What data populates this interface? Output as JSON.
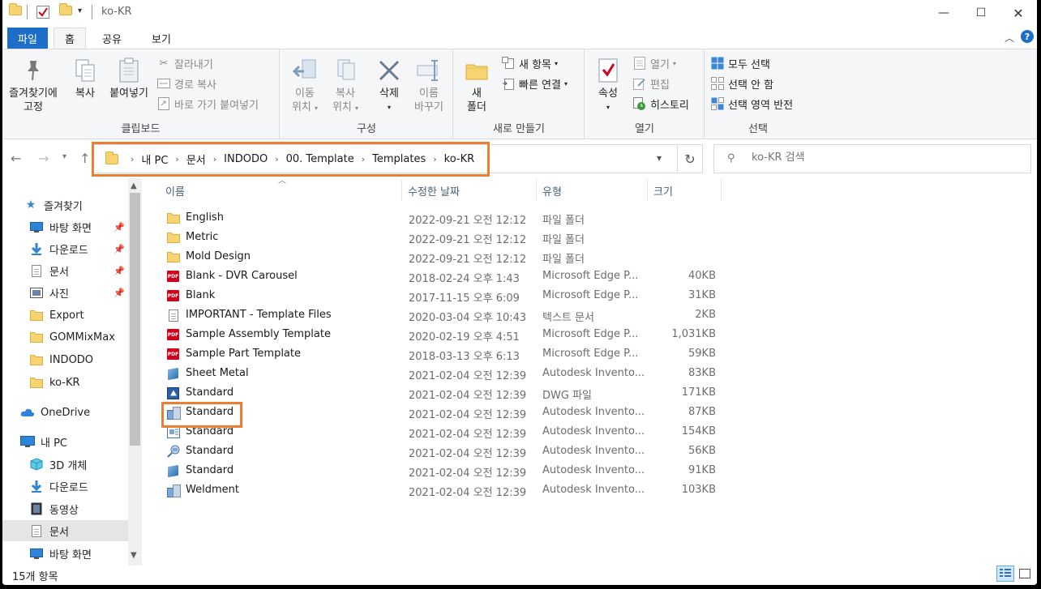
{
  "window": {
    "title": "ko-KR"
  },
  "tabs": [
    "파일",
    "홈",
    "공유",
    "보기"
  ],
  "ribbon": {
    "clipboard": {
      "label": "클립보드",
      "pin": "즐겨찾기에\n고정",
      "pin_l1": "즐겨찾기에",
      "pin_l2": "고정",
      "copy": "복사",
      "paste": "붙여넣기",
      "cut": "잘라내기",
      "copy_path": "경로 복사",
      "paste_shortcut": "바로 가기 붙여넣기"
    },
    "organize": {
      "label": "구성",
      "move_l1": "이동",
      "move_l2": "위치",
      "copyto_l1": "복사",
      "copyto_l2": "위치",
      "delete": "삭제",
      "rename_l1": "이름",
      "rename_l2": "바꾸기"
    },
    "new": {
      "label": "새로 만들기",
      "folder_l1": "새",
      "folder_l2": "폴더",
      "new_item": "새 항목",
      "easy_access": "빠른 연결"
    },
    "open": {
      "label": "열기",
      "properties": "속성",
      "open": "열기",
      "edit": "편집",
      "history": "히스토리"
    },
    "select": {
      "label": "선택",
      "select_all": "모두 선택",
      "select_none": "선택 안 함",
      "invert": "선택 영역 반전"
    }
  },
  "address": {
    "crumbs": [
      "내 PC",
      "문서",
      "INDODO",
      "00. Template",
      "Templates",
      "ko-KR"
    ]
  },
  "search": {
    "placeholder": "ko-KR 검색"
  },
  "nav": {
    "quick_access": "즐겨찾기",
    "items": [
      {
        "label": "바탕 화면",
        "pinned": true
      },
      {
        "label": "다운로드",
        "pinned": true
      },
      {
        "label": "문서",
        "pinned": true
      },
      {
        "label": "사진",
        "pinned": true
      },
      {
        "label": "Export"
      },
      {
        "label": "GOMMixMax"
      },
      {
        "label": "INDODO"
      },
      {
        "label": "ko-KR"
      }
    ],
    "onedrive": "OneDrive",
    "this_pc": "내 PC",
    "pc_items": [
      "3D 개체",
      "다운로드",
      "동영상",
      "문서",
      "바탕 화면"
    ]
  },
  "columns": {
    "name": "이름",
    "date": "수정한 날짜",
    "type": "유형",
    "size": "크기"
  },
  "files": [
    {
      "name": "English",
      "date": "2022-09-21 오전 12:12",
      "type": "파일 폴더",
      "size": "",
      "icon": "folder-icon"
    },
    {
      "name": "Metric",
      "date": "2022-09-21 오전 12:12",
      "type": "파일 폴더",
      "size": "",
      "icon": "folder-icon"
    },
    {
      "name": "Mold Design",
      "date": "2022-09-21 오전 12:12",
      "type": "파일 폴더",
      "size": "",
      "icon": "folder-icon"
    },
    {
      "name": "Blank - DVR Carousel",
      "date": "2018-02-24 오후 1:43",
      "type": "Microsoft Edge P...",
      "size": "40KB",
      "icon": "pdf-icon"
    },
    {
      "name": "Blank",
      "date": "2017-11-15 오후 6:09",
      "type": "Microsoft Edge P...",
      "size": "31KB",
      "icon": "pdf-icon"
    },
    {
      "name": "IMPORTANT - Template Files",
      "date": "2020-03-04 오후 10:43",
      "type": "텍스트 문서",
      "size": "2KB",
      "icon": "text-file-icon"
    },
    {
      "name": "Sample Assembly Template",
      "date": "2020-02-19 오후 4:51",
      "type": "Microsoft Edge P...",
      "size": "1,031KB",
      "icon": "pdf-icon"
    },
    {
      "name": "Sample Part Template",
      "date": "2018-03-13 오후 6:13",
      "type": "Microsoft Edge P...",
      "size": "59KB",
      "icon": "pdf-icon"
    },
    {
      "name": "Sheet Metal",
      "date": "2021-02-04 오전 12:39",
      "type": "Autodesk Invento...",
      "size": "83KB",
      "icon": "part-icon"
    },
    {
      "name": "Standard",
      "date": "2021-02-04 오전 12:39",
      "type": "DWG 파일",
      "size": "171KB",
      "icon": "dwg-icon"
    },
    {
      "name": "Standard",
      "date": "2021-02-04 오전 12:39",
      "type": "Autodesk Invento...",
      "size": "87KB",
      "icon": "assembly-icon"
    },
    {
      "name": "Standard",
      "date": "2021-02-04 오전 12:39",
      "type": "Autodesk Invento...",
      "size": "154KB",
      "icon": "drawing-icon"
    },
    {
      "name": "Standard",
      "date": "2021-02-04 오전 12:39",
      "type": "Autodesk Invento...",
      "size": "56KB",
      "icon": "presentation-icon"
    },
    {
      "name": "Standard",
      "date": "2021-02-04 오전 12:39",
      "type": "Autodesk Invento...",
      "size": "91KB",
      "icon": "part-icon"
    },
    {
      "name": "Weldment",
      "date": "2021-02-04 오전 12:39",
      "type": "Autodesk Invento...",
      "size": "103KB",
      "icon": "assembly-icon"
    }
  ],
  "status": {
    "count": "15개 항목"
  },
  "colors": {
    "accent": "#1c6ec9",
    "highlight": "#ed7d31",
    "selected": "#cce8ff"
  }
}
